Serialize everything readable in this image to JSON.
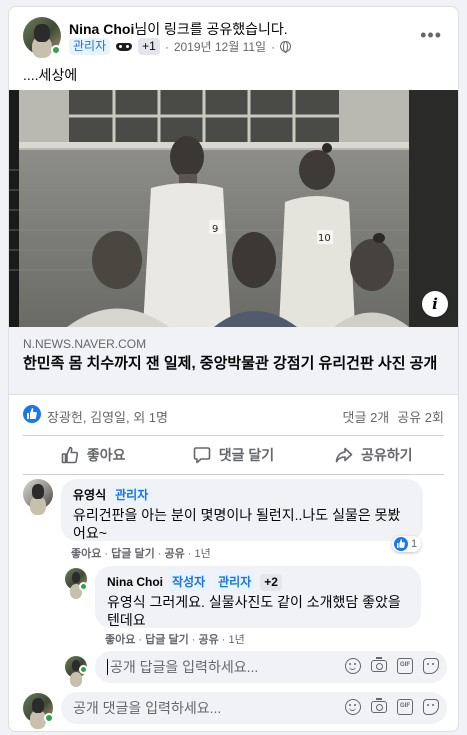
{
  "post": {
    "author": "Nina Choi",
    "action_text": "님이 링크를 공유했습니다.",
    "role_badge": "관리자",
    "badge_count": "+1",
    "date": "2019년 12월 11일",
    "separator": "·",
    "text": "....세상에",
    "more_icon": "more-horizontal-icon",
    "photo_numbers": [
      "9",
      "10"
    ]
  },
  "link": {
    "domain": "N.NEWS.NAVER.COM",
    "title": "한민족 몸 치수까지 잰 일제, 중앙박물관 강점기 유리건판 사진 공개",
    "info_icon": "i"
  },
  "stats": {
    "reactors": "장광헌, 김영일, 외 1명",
    "comments": "댓글 2개",
    "shares": "공유 2회"
  },
  "actions": {
    "like": "좋아요",
    "comment": "댓글 달기",
    "share": "공유하기"
  },
  "comments": [
    {
      "name": "유영식",
      "badge": "관리자",
      "text": "유리건판을 아는 분이 몇명이나 될런지..나도 실물은 못봤어요~",
      "meta_like": "좋아요",
      "meta_reply": "답글 달기",
      "meta_share": "공유",
      "meta_time": "1년",
      "reaction_count": "1"
    }
  ],
  "reply": {
    "name": "Nina Choi",
    "badge_author": "작성자",
    "badge_admin": "관리자",
    "badge_count": "+2",
    "text": "유영식 그러게요. 실물사진도 같이 소개했담 좋았을텐데요",
    "meta_like": "좋아요",
    "meta_reply": "답글 달기",
    "meta_share": "공유",
    "meta_time": "1년"
  },
  "inputs": {
    "reply_placeholder": "공개 답글을 입력하세요...",
    "comment_placeholder": "공개 댓글을 입력하세요...",
    "gif_label": "GIF"
  },
  "colors": {
    "accent": "#1877f2",
    "online": "#31a24c",
    "meta_text": "#65676b",
    "bubble_bg": "#f0f2f5"
  }
}
